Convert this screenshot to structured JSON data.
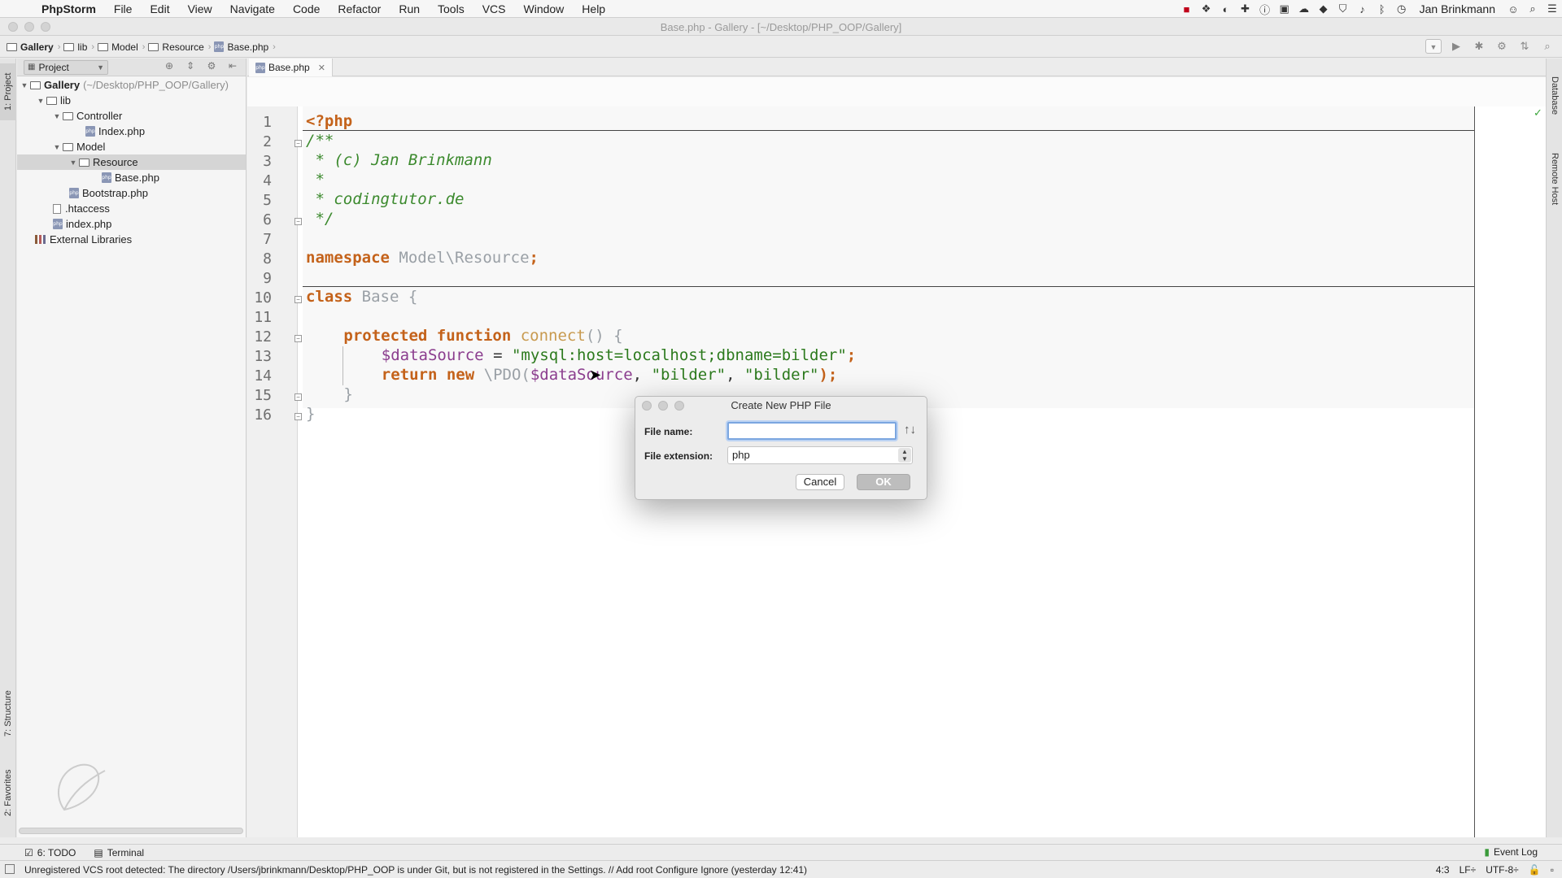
{
  "menubar": {
    "app": "PhpStorm",
    "items": [
      "File",
      "Edit",
      "View",
      "Navigate",
      "Code",
      "Refactor",
      "Run",
      "Tools",
      "VCS",
      "Window",
      "Help"
    ],
    "user": "Jan Brinkmann"
  },
  "window": {
    "title": "Base.php - Gallery - [~/Desktop/PHP_OOP/Gallery]"
  },
  "breadcrumb": [
    "Gallery",
    "lib",
    "Model",
    "Resource",
    "Base.php"
  ],
  "project_panel": {
    "selector_label": "Project",
    "tree": [
      {
        "label": "Gallery",
        "suffix": "(~/Desktop/PHP_OOP/Gallery)"
      },
      {
        "label": "lib"
      },
      {
        "label": "Controller"
      },
      {
        "label": "Index.php"
      },
      {
        "label": "Model"
      },
      {
        "label": "Resource"
      },
      {
        "label": "Base.php"
      },
      {
        "label": "Bootstrap.php"
      },
      {
        "label": ".htaccess"
      },
      {
        "label": "index.php"
      },
      {
        "label": "External Libraries"
      }
    ]
  },
  "side_tabs": {
    "project": "1: Project",
    "structure": "7: Structure",
    "favorites": "2: Favorites",
    "database": "Database",
    "remote_host": "Remote Host"
  },
  "editor": {
    "tab_label": "Base.php",
    "line_numbers": [
      "1",
      "2",
      "3",
      "4",
      "5",
      "6",
      "7",
      "8",
      "9",
      "10",
      "11",
      "12",
      "13",
      "14",
      "15",
      "16"
    ],
    "code": {
      "l1": "<?php",
      "l2": "/**",
      "l3_star": " * ",
      "l3": "(c) Jan Brinkmann",
      "l4": " *",
      "l5_star": " * ",
      "l5": "codingtutor.de",
      "l6": " */",
      "l8_kw": "namespace",
      "l8_name": " Model\\Resource",
      "l8_end": ";",
      "l10_kw": "class",
      "l10_name": " Base {",
      "l12_kw": "protected function",
      "l12_fn": " connect",
      "l12_rest": "() {",
      "l13_var": "$dataSource",
      "l13_eq": " = ",
      "l13_str": "\"mysql:host=localhost;dbname=bilder\"",
      "l13_end": ";",
      "l14_kw": "return new",
      "l14_cls": " \\PDO(",
      "l14_var": "$dataSource",
      "l14_sep1": ", ",
      "l14_str1": "\"bilder\"",
      "l14_sep2": ", ",
      "l14_str2": "\"bilder\"",
      "l14_end": ");",
      "l15": "}",
      "l16": "}"
    }
  },
  "dialog": {
    "title": "Create New PHP File",
    "file_name_label": "File name:",
    "file_name_value": "",
    "file_extension_label": "File extension:",
    "file_extension_value": "php",
    "cancel_label": "Cancel",
    "ok_label": "OK"
  },
  "bottom_tools": {
    "todo": "6: TODO",
    "terminal": "Terminal",
    "event_log": "Event Log"
  },
  "status": {
    "message": "Unregistered VCS root detected: The directory /Users/jbrinkmann/Desktop/PHP_OOP is under Git, but is not registered in the Settings. // Add root  Configure  Ignore (yesterday 12:41)",
    "position": "4:3",
    "line_sep": "LF÷",
    "encoding": "UTF-8÷"
  }
}
